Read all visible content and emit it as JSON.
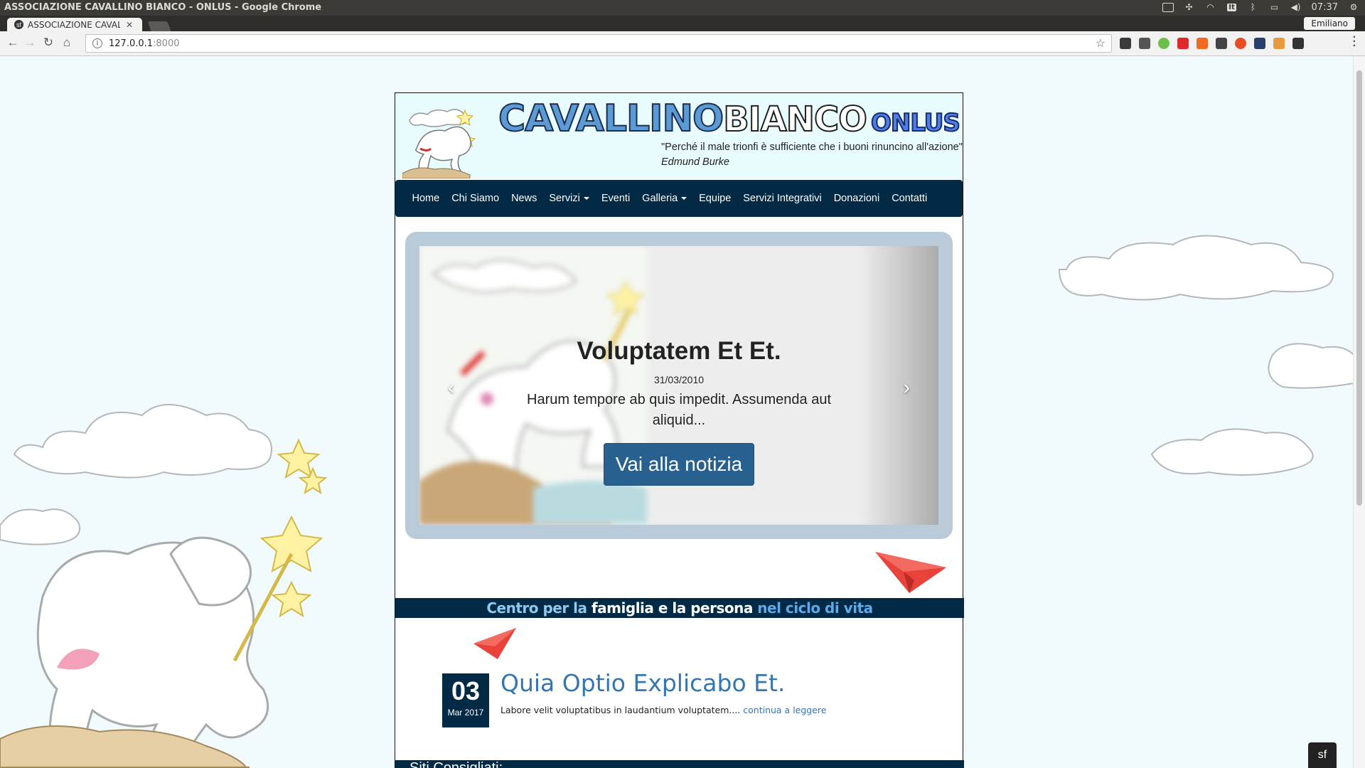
{
  "os": {
    "window_title": "ASSOCIAZIONE CAVALLINO BIANCO - ONLUS - Google Chrome",
    "clock": "07:37",
    "keyboard_layout": "It"
  },
  "browser": {
    "tab_title": "ASSOCIAZIONE CAVALLINO BIANCO - ONLUS",
    "tab_favicon": "sf-icon",
    "profile_name": "Emiliano",
    "url_host": "127.0.0.1",
    "url_port": ":8000"
  },
  "site": {
    "brand": {
      "part1": "CAVALLINO",
      "part2": "BIANCO",
      "part3": "ONLUS"
    },
    "quote": "\"Perché il male trionfi è sufficiente che i buoni rinuncino all'azione\"",
    "quote_author": "Edmund Burke",
    "nav": [
      {
        "label": "Home"
      },
      {
        "label": "Chi Siamo"
      },
      {
        "label": "News"
      },
      {
        "label": "Servizi"
      },
      {
        "label": "Eventi"
      },
      {
        "label": "Galleria"
      },
      {
        "label": "Equipe"
      },
      {
        "label": "Servizi Integrativi"
      },
      {
        "label": "Donazioni"
      },
      {
        "label": "Contatti"
      }
    ],
    "carousel": {
      "title": "Voluptatem Et Et.",
      "date": "31/03/2010",
      "text": "Harum tempore ab quis impedit. Assumenda aut aliquid...",
      "button": "Vai alla notizia"
    },
    "band": {
      "part1": "Centro per la",
      "part2": "famiglia e la persona",
      "part3": "nel ciclo di vita"
    },
    "news": {
      "day": "03",
      "month": "Mar 2017",
      "title": "Quia Optio Explicabo Et.",
      "excerpt": "Labore velit voluptatibus in laudantium voluptatem....",
      "more": "continua a leggere"
    },
    "footer_title": "Siti Consigliati:"
  },
  "colors": {
    "navy": "#022a44",
    "link_blue": "#3676b0",
    "button_blue": "#286090",
    "page_bg": "#f1fbfd",
    "plane_red": "#e8423a"
  }
}
